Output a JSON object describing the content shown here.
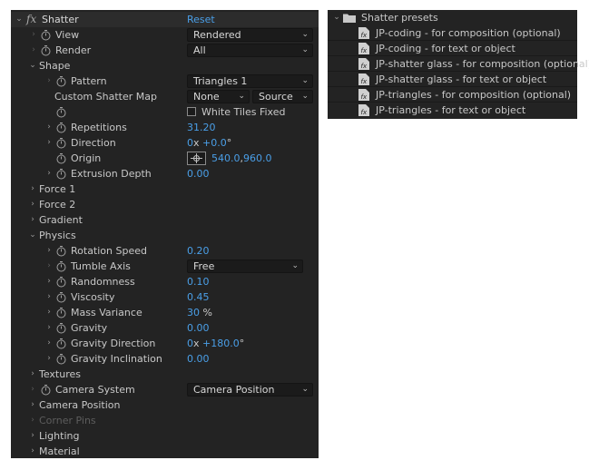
{
  "effect": {
    "name": "Shatter",
    "reset_label": "Reset",
    "properties": [
      {
        "label": "View",
        "value": "Rendered"
      },
      {
        "label": "Render",
        "value": "All"
      }
    ],
    "shape": {
      "label": "Shape",
      "pattern": {
        "label": "Pattern",
        "value": "Triangles 1"
      },
      "custom_map": {
        "label": "Custom Shatter Map",
        "value": "None",
        "source": "Source"
      },
      "white_tiles": {
        "label": "White Tiles Fixed",
        "checked": false
      },
      "repetitions": {
        "label": "Repetitions",
        "value": "31.20"
      },
      "direction": {
        "label": "Direction",
        "revolutions": "0",
        "x": "x",
        "degrees": "+0.0",
        "unit": "°"
      },
      "origin": {
        "label": "Origin",
        "x": "540.0",
        "sep": ",",
        "y": "960.0"
      },
      "extrusion": {
        "label": "Extrusion Depth",
        "value": "0.00"
      }
    },
    "groups_a": [
      {
        "label": "Force 1"
      },
      {
        "label": "Force 2"
      },
      {
        "label": "Gradient"
      }
    ],
    "physics": {
      "label": "Physics",
      "rotation_speed": {
        "label": "Rotation Speed",
        "value": "0.20"
      },
      "tumble_axis": {
        "label": "Tumble Axis",
        "value": "Free"
      },
      "randomness": {
        "label": "Randomness",
        "value": "0.10"
      },
      "viscosity": {
        "label": "Viscosity",
        "value": "0.45"
      },
      "mass_variance": {
        "label": "Mass Variance",
        "value": "30",
        "unit": "%"
      },
      "gravity": {
        "label": "Gravity",
        "value": "0.00"
      },
      "gravity_direction": {
        "label": "Gravity Direction",
        "revolutions": "0",
        "x": "x",
        "degrees": "+180.0",
        "unit": "°"
      },
      "gravity_inclination": {
        "label": "Gravity Inclination",
        "value": "0.00"
      }
    },
    "textures": {
      "label": "Textures"
    },
    "camera_system": {
      "label": "Camera System",
      "value": "Camera Position"
    },
    "groups_b": [
      {
        "label": "Camera Position"
      },
      {
        "label": "Corner Pins"
      },
      {
        "label": "Lighting"
      },
      {
        "label": "Material"
      }
    ]
  },
  "presets": {
    "folder": "Shatter presets",
    "items": [
      "JP-coding - for composition (optional)",
      "JP-coding - for text or object",
      "JP-shatter glass - for composition (optional)",
      "JP-shatter glass - for text or object",
      "JP-triangles - for composition (optional)",
      "JP-triangles - for text or object"
    ]
  },
  "colors": {
    "panel_bg": "#232323",
    "value_blue": "#4a9fe8",
    "label": "#c8c8c8",
    "disabled": "#5d5d5d"
  }
}
